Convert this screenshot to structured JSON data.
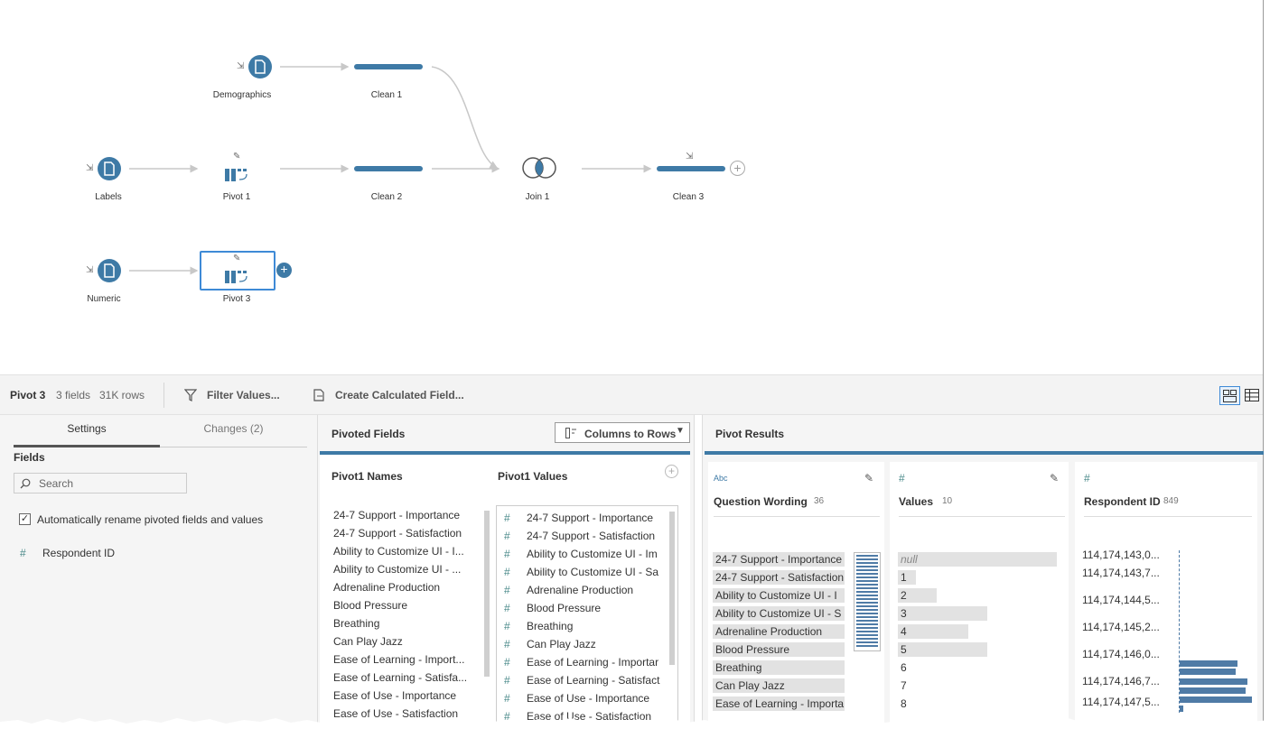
{
  "flow": {
    "nodes": {
      "demographics": "Demographics",
      "labels": "Labels",
      "numeric": "Numeric",
      "pivot1": "Pivot 1",
      "pivot3": "Pivot 3",
      "clean1": "Clean 1",
      "clean2": "Clean 2",
      "clean3": "Clean 3",
      "join1": "Join 1"
    },
    "accent_color": "#3e7aa6"
  },
  "toolbar": {
    "step_name": "Pivot 3",
    "fields_count": "3 fields",
    "rows_count": "31K rows",
    "filter_label": "Filter Values...",
    "calc_label": "Create Calculated Field..."
  },
  "settings": {
    "tab_settings": "Settings",
    "tab_changes": "Changes (2)",
    "fields_heading": "Fields",
    "search_placeholder": "Search",
    "auto_rename_label": "Automatically rename pivoted fields and values",
    "field_item": "Respondent ID"
  },
  "pivoted_fields": {
    "title": "Pivoted Fields",
    "mode_label": "Columns to Rows",
    "names_header": "Pivot1 Names",
    "values_header": "Pivot1 Values",
    "names": [
      "24-7 Support - Importance",
      "24-7 Support - Satisfaction",
      "Ability to Customize UI - I...",
      "Ability to Customize UI - ...",
      "Adrenaline Production",
      "Blood Pressure",
      "Breathing",
      "Can Play Jazz",
      "Ease of Learning - Import...",
      "Ease of Learning - Satisfa...",
      "Ease of Use - Importance",
      "Ease of Use - Satisfaction"
    ],
    "values": [
      "24-7 Support - Importance",
      "24-7 Support - Satisfaction",
      "Ability to Customize UI - Im",
      "Ability to Customize UI - Sa",
      "Adrenaline Production",
      "Blood Pressure",
      "Breathing",
      "Can Play Jazz",
      "Ease of Learning - Importar",
      "Ease of Learning - Satisfact",
      "Ease of Use - Importance",
      "Ease of Use - Satisfaction"
    ]
  },
  "results": {
    "title": "Pivot Results",
    "col1": {
      "type_label": "Abc",
      "name": "Question Wording",
      "count": "36",
      "items": [
        "24-7 Support - Importance",
        "24-7 Support - Satisfaction",
        "Ability to Customize UI - I",
        "Ability to Customize UI - S",
        "Adrenaline Production",
        "Blood Pressure",
        "Breathing",
        "Can Play Jazz",
        "Ease of Learning - Importa"
      ]
    },
    "col2": {
      "type_label": "#",
      "name": "Values",
      "count": "10",
      "items": [
        "null",
        "1",
        "2",
        "3",
        "4",
        "5",
        "6",
        "7",
        "8"
      ]
    },
    "col3": {
      "type_label": "#",
      "name": "Respondent ID",
      "count": "849",
      "items": [
        "114,174,143,0...",
        "114,174,143,7...",
        "114,174,144,5...",
        "114,174,145,2...",
        "114,174,146,0...",
        "114,174,146,7...",
        "114,174,147,5..."
      ]
    }
  }
}
